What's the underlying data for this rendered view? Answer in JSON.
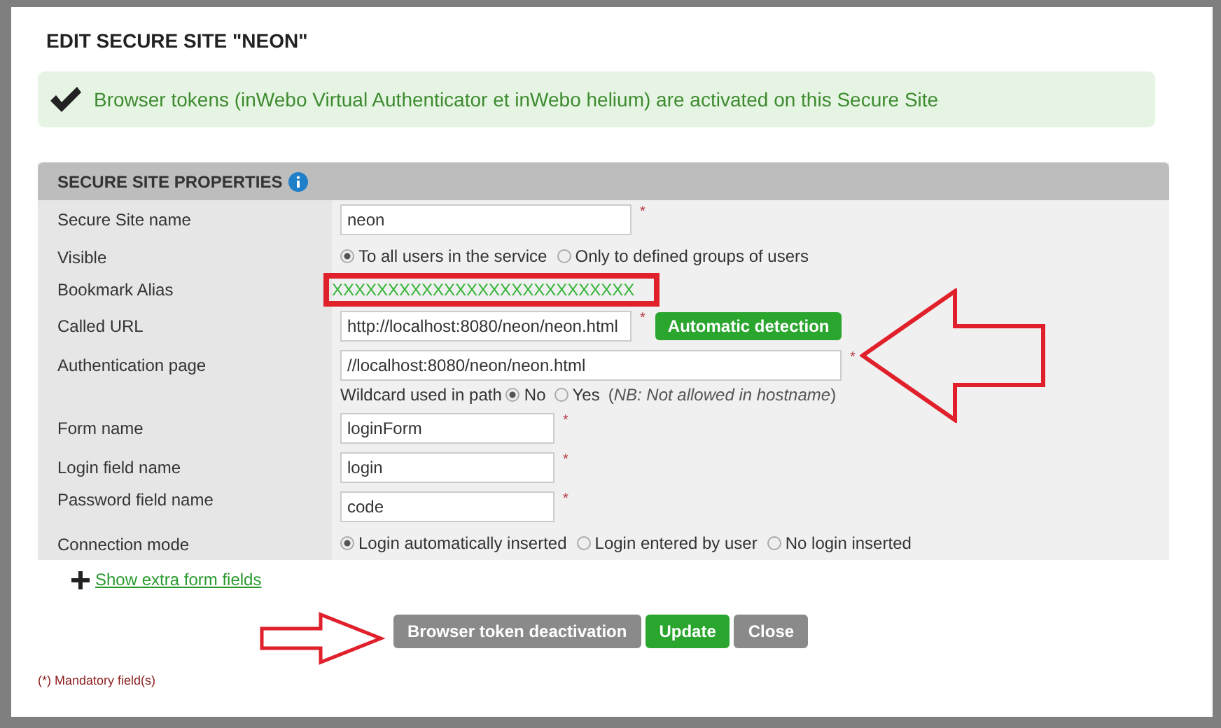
{
  "dialog": {
    "title": "EDIT SECURE SITE \"NEON\""
  },
  "alert": {
    "text": "Browser tokens (inWebo Virtual Authenticator et inWebo helium) are activated on this Secure Site"
  },
  "section": {
    "title": "SECURE SITE PROPERTIES"
  },
  "rows": [
    {
      "label": "Secure Site name",
      "kind": "input",
      "value": "neon",
      "required_mark": "*"
    },
    {
      "label": "Visible",
      "kind": "radios",
      "options": [
        {
          "label": "To all users in the service",
          "selected": true
        },
        {
          "label": "Only to defined groups of users",
          "selected": false
        }
      ]
    },
    {
      "label": "Bookmark Alias",
      "kind": "alias",
      "value": "XXXXXXXXXXXXXXXXXXXXXXXXXXX",
      "highlighted": true
    },
    {
      "label": "Called URL",
      "kind": "input",
      "value": "http://localhost:8080/neon/neon.html",
      "required_mark": "*",
      "action": "Automatic detection"
    },
    {
      "label": "Authentication page",
      "kind": "input",
      "value": "//localhost:8080/neon/neon.html",
      "required_mark": "*",
      "sub": {
        "label": "Wildcard used in path",
        "options": [
          {
            "label": "No",
            "selected": true
          },
          {
            "label": "Yes",
            "selected": false
          }
        ],
        "note": "(*NB: Not allowed in hostname*)"
      }
    },
    {
      "label": "Form name",
      "kind": "input",
      "value": "loginForm",
      "required_mark": "*"
    },
    {
      "label": "Login field name",
      "kind": "input",
      "value": "login",
      "required_mark": "*"
    },
    {
      "label": "Password field name",
      "kind": "input",
      "value": "code",
      "required_mark": "*"
    },
    {
      "label": "Connection mode",
      "kind": "radios",
      "options": [
        {
          "label": "Login automatically inserted",
          "selected": true
        },
        {
          "label": "Login entered by user",
          "selected": false
        },
        {
          "label": "No login inserted",
          "selected": false
        }
      ]
    }
  ],
  "extra_link": "Show extra form fields",
  "buttons": [
    {
      "label": "Browser token deactivation",
      "kind": "secondary"
    },
    {
      "label": "Update",
      "kind": "primary"
    },
    {
      "label": "Close",
      "kind": "secondary"
    }
  ],
  "footnote": "(*) Mandatory field(s)"
}
